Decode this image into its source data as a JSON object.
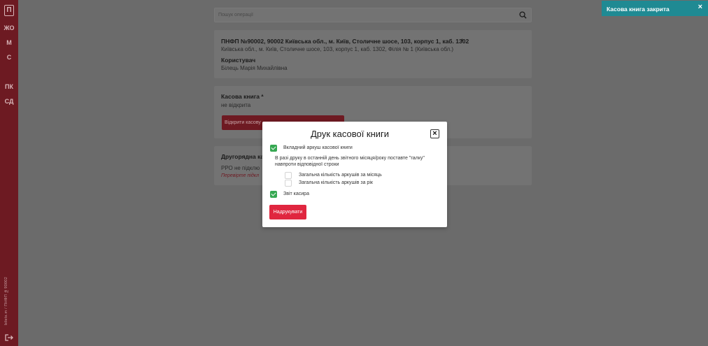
{
  "sidebar": {
    "logo": "П",
    "items": [
      {
        "label": "ЖО"
      },
      {
        "label": "М"
      },
      {
        "label": "С"
      },
      {
        "label": "ПК"
      },
      {
        "label": "СД"
      }
    ],
    "vertical_text": "bilets.m / ПНФП №90002",
    "exit_icon": "logout-icon"
  },
  "search": {
    "placeholder": "Пошук операції",
    "icon": "search-icon"
  },
  "card1": {
    "title": "ПНФП №90002, 90002 Київська обл., м. Київ, Столичне шосе, 103, корпус 1, каб. 1302",
    "address": "Київська обл., м. Київ, Столичне шосе, 103, корпус 1, каб. 1302, Філія № 1 (Київська обл.)",
    "user_label": "Користувач",
    "user_name": "Білець Марія Михайлівна"
  },
  "card2": {
    "title": "Касова книга",
    "status": "не відкрита",
    "button": "Відкрити касову"
  },
  "card3": {
    "title": "Другорядна ка",
    "status": "РРО не підклю",
    "link": "Перевірте підкл"
  },
  "toast": {
    "text": "Касова книга закрита",
    "close": "×",
    "color": "#1f8a93"
  },
  "modal": {
    "title": "Друк касової книги",
    "close": "×",
    "option1": {
      "label": "Вкладний аркуш касової книги",
      "checked": true
    },
    "note": "В разі друку в останній день звітного місяця/року поставте \"галку\" навпроти відповідної строки",
    "option2": {
      "label": "Загальна кількість аркушів за місяць",
      "checked": false
    },
    "option3": {
      "label": "Загальна кількість аркушів за рік",
      "checked": false
    },
    "option4": {
      "label": "Звіт касира",
      "checked": true
    },
    "print_button": "Надрукувати",
    "accent": "#e0263f",
    "check_color": "#36a852"
  }
}
